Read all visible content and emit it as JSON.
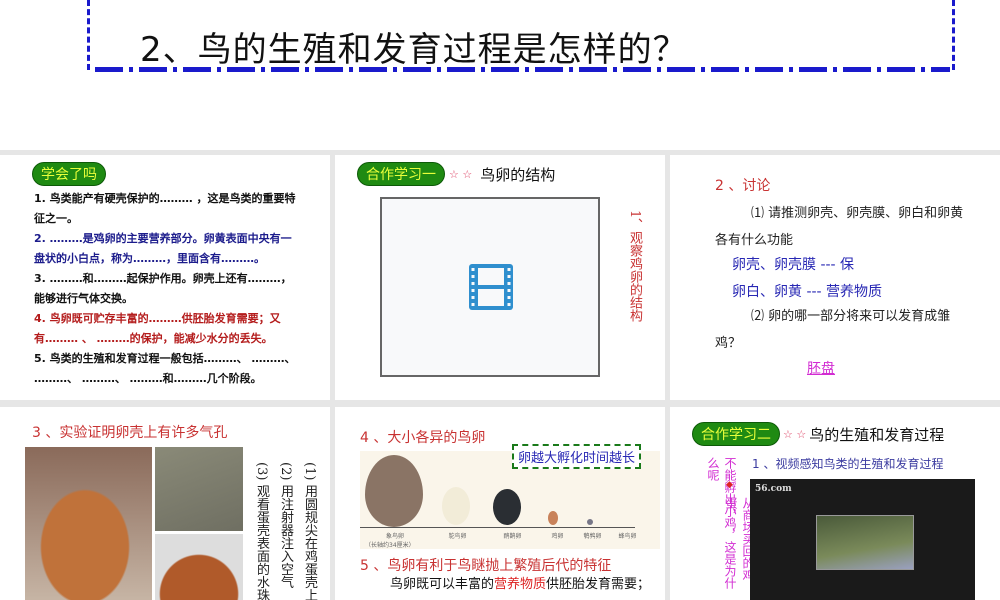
{
  "title": "2、鸟的生殖和发育过程是怎样的？",
  "panel1": {
    "badge": "学会了吗",
    "items": [
      "1. 鸟类能产有硬壳保护的……… ，这是鸟类的重要特征之一。",
      "2.  ………是鸡卵的主要营养部分。卵黄表面中央有一盘状的小白点，称为………，里面含有………。",
      "3. ………和………起保护作用。卵壳上还有………，能够进行气体交换。",
      "4. 鸟卵既可贮存丰富的………供胚胎发育需要；又有……… 、 ………的保护，能减少水分的丢失。",
      "5. 鸟类的生殖和发育过程一般包括………、 ………、 ………、 ………、 ………和………几个阶段。"
    ]
  },
  "panel2": {
    "badge": "合作学习一",
    "stars": "☆ ☆",
    "heading": "鸟卵的结构",
    "side": "1、观察鸡卵的结构",
    "icon": "video-icon"
  },
  "panel3": {
    "heading": "2 、讨论",
    "q1": "⑴ 请推测卵壳、卵壳膜、卵白和卵黄各有什么功能",
    "a1": "卵壳、卵壳膜 --- 保",
    "a2": "卵白、卵黄 --- 营养物质",
    "q2": "⑵ 卵的哪一部分将来可以发育成雏鸡？",
    "a3": "胚盘"
  },
  "panel4": {
    "heading": "3 、实验证明卵壳上有许多气孔",
    "steps": [
      "(1) 用圆规尖在鸡蛋壳上",
      "(2) 用注射器注入空气",
      "(3) 观看蛋壳表面的水珠"
    ]
  },
  "panel5": {
    "heading": "4 、大小各异的鸟卵",
    "callout": "卵越大孵化时间越长",
    "eggs": [
      "象鸟卵",
      "鸵鸟卵",
      "鸸鹋卵",
      "鸡卵",
      "鹌鹑卵",
      "蜂鸟卵"
    ],
    "note": "（长轴约34厘米）",
    "heading2": "5 、鸟卵有利于鸟瞇抛上繁殖后代的特征",
    "text_a": "鸟卵既可以丰富的",
    "text_hl": "营养物质",
    "text_b": "供胚胎发育需要；"
  },
  "panel6": {
    "badge": "合作学习二",
    "stars": "☆ ☆",
    "heading": "鸟的生殖和发育过程",
    "sub": "1 、视频感知鸟类的生殖和发育过程",
    "side1": "不能孵出小鸡，这是为什么呢",
    "side2": "从商场买回的鸡蛋，",
    "bullet": "◆",
    "watermark": "56.com"
  }
}
